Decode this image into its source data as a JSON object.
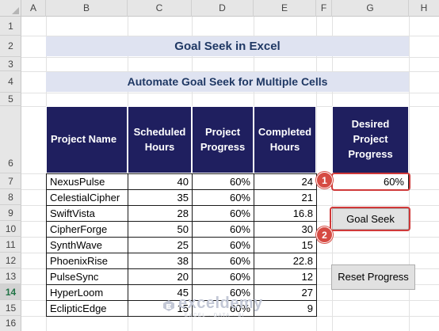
{
  "columns": [
    "A",
    "B",
    "C",
    "D",
    "E",
    "F",
    "G",
    "H"
  ],
  "rows": [
    "1",
    "2",
    "3",
    "4",
    "5",
    "6",
    "7",
    "8",
    "9",
    "10",
    "11",
    "12",
    "13",
    "14",
    "15",
    "16"
  ],
  "selected_row": "14",
  "title": "Goal Seek in Excel",
  "subtitle": "Automate Goal Seek for Multiple Cells",
  "table": {
    "headers": [
      "Project Name",
      "Scheduled Hours",
      "Project Progress",
      "Completed Hours"
    ],
    "rows": [
      {
        "name": "NexusPulse",
        "scheduled": "40",
        "progress": "60%",
        "completed": "24"
      },
      {
        "name": "CelestialCipher",
        "scheduled": "35",
        "progress": "60%",
        "completed": "21"
      },
      {
        "name": "SwiftVista",
        "scheduled": "28",
        "progress": "60%",
        "completed": "16.8"
      },
      {
        "name": "CipherForge",
        "scheduled": "50",
        "progress": "60%",
        "completed": "30"
      },
      {
        "name": "SynthWave",
        "scheduled": "25",
        "progress": "60%",
        "completed": "15"
      },
      {
        "name": "PhoenixRise",
        "scheduled": "38",
        "progress": "60%",
        "completed": "22.8"
      },
      {
        "name": "PulseSync",
        "scheduled": "20",
        "progress": "60%",
        "completed": "12"
      },
      {
        "name": "HyperLoom",
        "scheduled": "45",
        "progress": "60%",
        "completed": "27"
      },
      {
        "name": "EclipticEdge",
        "scheduled": "15",
        "progress": "60%",
        "completed": "9"
      }
    ]
  },
  "desired": {
    "header": "Desired Project Progress",
    "value": "60%"
  },
  "buttons": {
    "goal_seek": "Goal Seek",
    "reset": "Reset Progress"
  },
  "badges": [
    "1",
    "2"
  ],
  "watermark": {
    "brand": "exceldemy",
    "tagline": "EXCEL · DATA · BI"
  },
  "colors": {
    "header_fill": "#1f1f5f",
    "banner_fill": "#dfe3f1",
    "banner_text": "#1f3864",
    "badge": "#d64b43",
    "highlight": "#d03939"
  }
}
